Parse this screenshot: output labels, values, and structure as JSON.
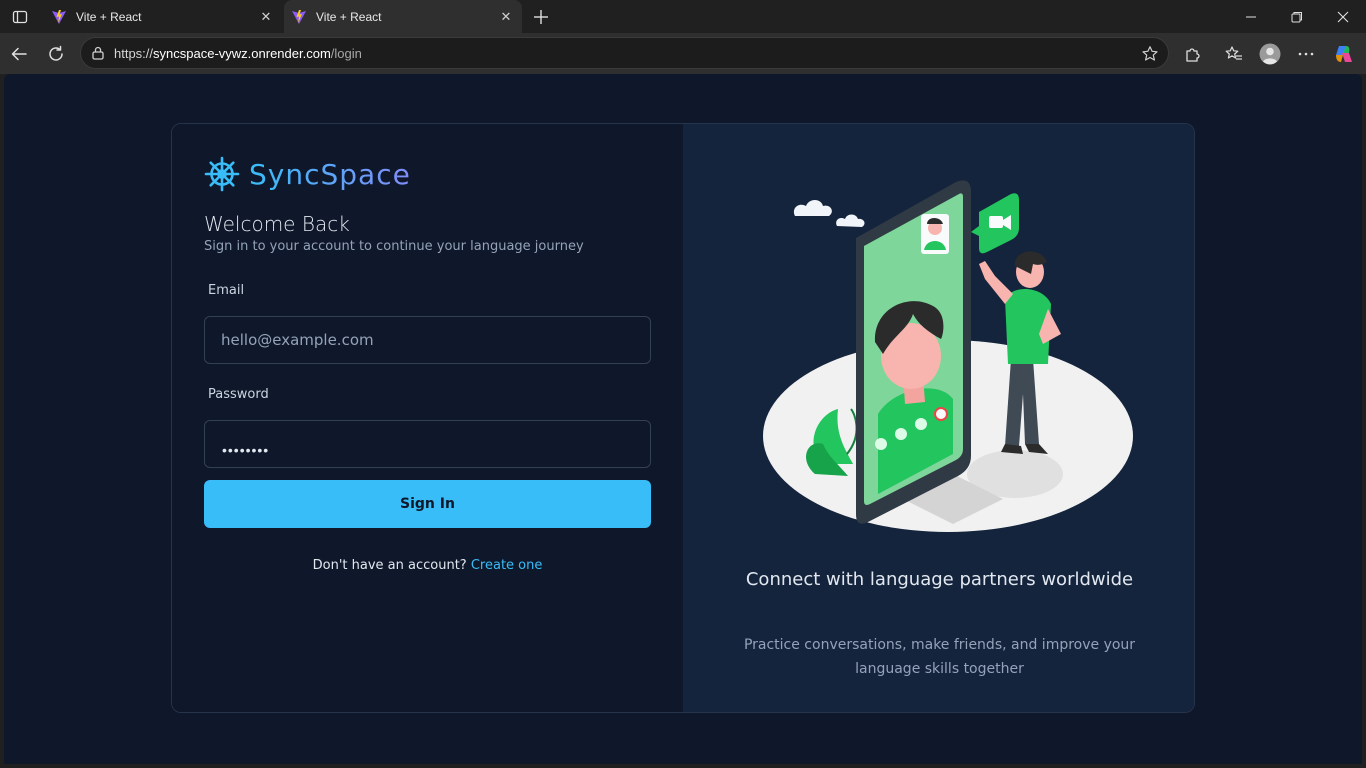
{
  "browser": {
    "tabs": [
      {
        "title": "Vite + React",
        "active": false
      },
      {
        "title": "Vite + React",
        "active": true
      }
    ],
    "url": {
      "scheme": "https://",
      "host": "syncspace-vywz.onrender.com",
      "path": "/login"
    },
    "accent": "#38bdf8"
  },
  "login": {
    "brand": "SyncSpace",
    "welcome": "Welcome Back",
    "subtitle": "Sign in to your account to continue your language journey",
    "email_label": "Email",
    "email_placeholder": "hello@example.com",
    "password_label": "Password",
    "password_mask": "••••••••",
    "signin_label": "Sign In",
    "signup_prompt": "Don't have an account?",
    "signup_link": "Create one"
  },
  "promo": {
    "title": "Connect with language partners worldwide",
    "description": "Practice conversations, make friends, and improve your language skills together"
  },
  "icons": {
    "tab_actions": "tab-actions-icon",
    "favicon": "vite-logo-icon",
    "back": "back-arrow-icon",
    "refresh": "refresh-icon",
    "lock": "lock-icon",
    "favorite": "star-icon",
    "brand_logo": "ship-wheel-icon"
  }
}
